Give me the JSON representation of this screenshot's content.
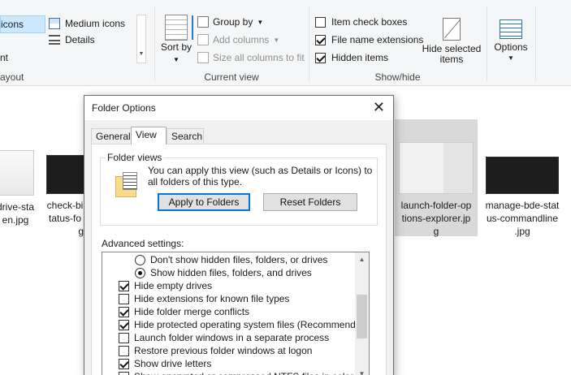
{
  "ribbon": {
    "layout": {
      "selected_label": "icons",
      "medium_icons": "Medium icons",
      "details": "Details",
      "partial_label": "nt",
      "group_label": "ayout"
    },
    "current_view": {
      "sort_by": "Sort by",
      "group_by": "Group by",
      "add_columns": "Add columns",
      "size_all_columns": "Size all columns to fit",
      "group_label": "Current view"
    },
    "show_hide": {
      "item_check_boxes": {
        "label": "Item check boxes",
        "checked": false
      },
      "file_name_extensions": {
        "label": "File name extensions",
        "checked": true
      },
      "hidden_items": {
        "label": "Hidden items",
        "checked": true
      },
      "hide_selected_items": "Hide selected items",
      "group_label": "Show/hide"
    },
    "options": "Options"
  },
  "files": [
    {
      "name": "drive-sta en.jpg",
      "line1": "drive-sta",
      "line2": "en.jpg",
      "line3": ""
    },
    {
      "name": "check-bi tatus-fo",
      "line1": "check-bi",
      "line2": "tatus-fo",
      "line3": "g"
    },
    {
      "name": "launch-folder-options-explorer.jpg",
      "line1": "launch-folder-op",
      "line2": "tions-explorer.jp",
      "line3": "g"
    },
    {
      "name": "manage-bde-status-commandline.jpg",
      "line1": "manage-bde-stat",
      "line2": "us-commandline",
      "line3": ".jpg"
    }
  ],
  "dialog": {
    "title": "Folder Options",
    "tabs": [
      "General",
      "View",
      "Search"
    ],
    "active_tab": "View",
    "folder_views": {
      "legend": "Folder views",
      "description": "You can apply this view (such as Details or Icons) to all folders of this type.",
      "apply_button": "Apply to Folders",
      "reset_button": "Reset Folders"
    },
    "advanced_label": "Advanced settings:",
    "advanced_items": [
      {
        "type": "radio",
        "label": "Don't show hidden files, folders, or drives",
        "checked": false,
        "indent": true
      },
      {
        "type": "radio",
        "label": "Show hidden files, folders, and drives",
        "checked": true,
        "indent": true
      },
      {
        "type": "checkbox",
        "label": "Hide empty drives",
        "checked": true,
        "indent": false
      },
      {
        "type": "checkbox",
        "label": "Hide extensions for known file types",
        "checked": false,
        "indent": false
      },
      {
        "type": "checkbox",
        "label": "Hide folder merge conflicts",
        "checked": true,
        "indent": false
      },
      {
        "type": "checkbox",
        "label": "Hide protected operating system files (Recommended)",
        "checked": true,
        "indent": false
      },
      {
        "type": "checkbox",
        "label": "Launch folder windows in a separate process",
        "checked": false,
        "indent": false
      },
      {
        "type": "checkbox",
        "label": "Restore previous folder windows at logon",
        "checked": false,
        "indent": false
      },
      {
        "type": "checkbox",
        "label": "Show drive letters",
        "checked": true,
        "indent": false
      },
      {
        "type": "checkbox",
        "label": "Show encrypted or compressed NTFS files in color",
        "checked": false,
        "indent": false
      }
    ]
  }
}
